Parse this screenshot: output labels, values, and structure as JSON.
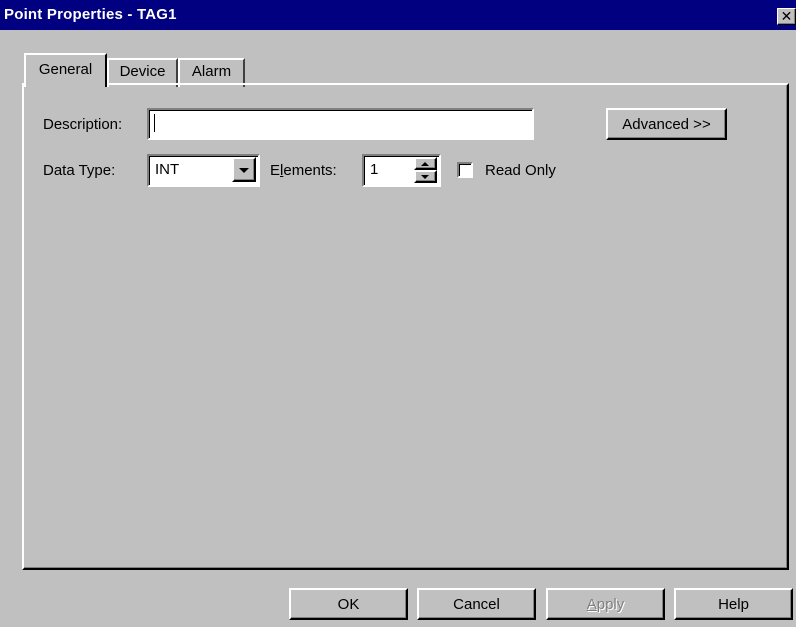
{
  "window": {
    "title": "Point Properties - TAG1",
    "close_glyph": "✕"
  },
  "tabs": [
    {
      "label": "General",
      "active": true
    },
    {
      "label": "Device",
      "active": false
    },
    {
      "label": "Alarm",
      "active": false
    }
  ],
  "general": {
    "description_label": "Description:",
    "description_value": "",
    "advanced_button": "Advanced >>",
    "data_type_label": "Data Type:",
    "data_type_value": "INT",
    "elements_label_pre": "E",
    "elements_label_hotkey": "l",
    "elements_label_post": "ements:",
    "elements_value": "1",
    "read_only_label": "Read Only",
    "read_only_checked": false
  },
  "buttons": {
    "ok": "OK",
    "cancel": "Cancel",
    "apply_hotkey": "A",
    "apply_rest": "pply",
    "help": "Help"
  },
  "colors": {
    "titlebar": "#000080",
    "face": "#c0c0c0"
  }
}
